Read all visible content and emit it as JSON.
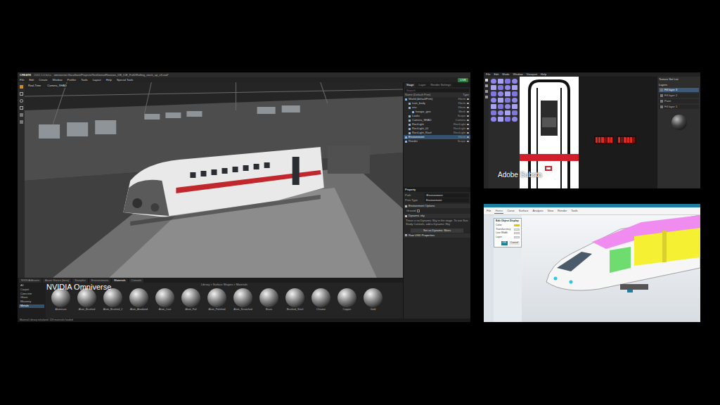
{
  "omniverse": {
    "caption": "NVIDIA Omniverse",
    "title": "CREATE",
    "version": "2022.1.0 beta",
    "path": "omniverse://localhost/Projects/TestDemo/Reviews_DB_ICE_Full2/Rolling_stock_up_v3.usd*",
    "menu": [
      "File",
      "Edit",
      "Create",
      "Window",
      "Profiler",
      "Tools",
      "Layout",
      "Help",
      "Special Tools"
    ],
    "live": "LIVE",
    "viewport_buttons": [
      "Real-Time",
      "Camera_SHAD"
    ],
    "stage_tabs": [
      {
        "label": "Stage",
        "selected": true
      },
      {
        "label": "Layer",
        "selected": false
      },
      {
        "label": "Render Settings",
        "selected": false
      }
    ],
    "stage_search": "Search",
    "stage_columns": [
      "Name (Default Prim)",
      "Type"
    ],
    "stage_items": [
      {
        "name": "World (defaultPrim)",
        "type": "Xform",
        "depth": 0,
        "selected": false
      },
      {
        "name": "train_body",
        "type": "Xform",
        "depth": 1,
        "selected": false
      },
      {
        "name": "env",
        "type": "Xform",
        "depth": 1,
        "selected": false
      },
      {
        "name": "hangar_geo",
        "type": "Mesh",
        "depth": 2,
        "selected": false
      },
      {
        "name": "Looks",
        "type": "Scope",
        "depth": 1,
        "selected": false
      },
      {
        "name": "Camera_SHAD",
        "type": "Camera",
        "depth": 1,
        "selected": false
      },
      {
        "name": "RectLight",
        "type": "RectLight",
        "depth": 1,
        "selected": false
      },
      {
        "name": "RectLight_01",
        "type": "RectLight",
        "depth": 1,
        "selected": false
      },
      {
        "name": "RectLight_Roof",
        "type": "RectLight",
        "depth": 1,
        "selected": false
      },
      {
        "name": "Environment",
        "type": "Xform",
        "depth": 0,
        "selected": true
      },
      {
        "name": "Render",
        "type": "Scope",
        "depth": 0,
        "selected": false
      }
    ],
    "property_title": "Property",
    "property_fields": [
      {
        "label": "Path",
        "value": "/Environment"
      },
      {
        "label": "Prim Type",
        "value": "Environment"
      }
    ],
    "property_sections": [
      {
        "title": "Environment Options",
        "expanded": true
      },
      {
        "title": "Dynamic sky",
        "expanded": true
      },
      {
        "title": "Raw USD Properties",
        "expanded": false
      }
    ],
    "ground_label": "Ground",
    "sky_note": "There is no Dynamic Sky in the stage. To use Sun Study Controls, add a Dynamic Sky",
    "sky_button": "Set as Dynamic Skies",
    "bottom_tabs": [
      {
        "label": "NVIDIA Assets",
        "selected": false
      },
      {
        "label": "Asset Stores (beta)",
        "selected": false
      },
      {
        "label": "Samples",
        "selected": false
      },
      {
        "label": "Environments",
        "selected": false
      },
      {
        "label": "Materials",
        "selected": true
      },
      {
        "label": "Console",
        "selected": false
      }
    ],
    "material_path": "Library > Surface Shapes > Materials",
    "material_categories": [
      {
        "label": "All",
        "selected": false
      },
      {
        "label": "Carpet",
        "selected": false
      },
      {
        "label": "Concrete",
        "selected": false
      },
      {
        "label": "Glass",
        "selected": false
      },
      {
        "label": "Masonry",
        "selected": false
      },
      {
        "label": "Metals",
        "selected": true
      }
    ],
    "materials": [
      "Aluminum",
      "Alum_Brushed",
      "Alum_Brushed_2",
      "Alum_Anodized",
      "Alum_Cast",
      "Alum_Foil",
      "Alum_Polished",
      "Alum_Scratched",
      "Brass",
      "Brushed_Steel",
      "Chrome",
      "Copper",
      "Gold"
    ],
    "status": "Material Library initialized; 118 materials loaded"
  },
  "substance": {
    "caption": "Adobe Substa",
    "menu": [
      "File",
      "Edit",
      "Mode",
      "Window",
      "Viewport",
      "Help"
    ],
    "panel_title": "Layers",
    "layers": [
      {
        "name": "Fill layer 3",
        "selected": true
      },
      {
        "name": "Fill layer 2",
        "selected": false
      },
      {
        "name": "Paint",
        "selected": false
      },
      {
        "name": "Fill layer 1",
        "selected": false
      }
    ],
    "texture_title": "Texture Set List"
  },
  "cad": {
    "tabs": [
      {
        "label": "File",
        "selected": false
      },
      {
        "label": "Home",
        "selected": true
      },
      {
        "label": "Curve",
        "selected": false
      },
      {
        "label": "Surface",
        "selected": false
      },
      {
        "label": "Analysis",
        "selected": false
      },
      {
        "label": "View",
        "selected": false
      },
      {
        "label": "Render",
        "selected": false
      },
      {
        "label": "Tools",
        "selected": false
      }
    ],
    "dialog_title": "Edit Object Display",
    "dialog_fields": [
      "Color",
      "Translucency",
      "Line Width",
      "Layer"
    ],
    "buttons": [
      "OK",
      "Cancel"
    ]
  }
}
